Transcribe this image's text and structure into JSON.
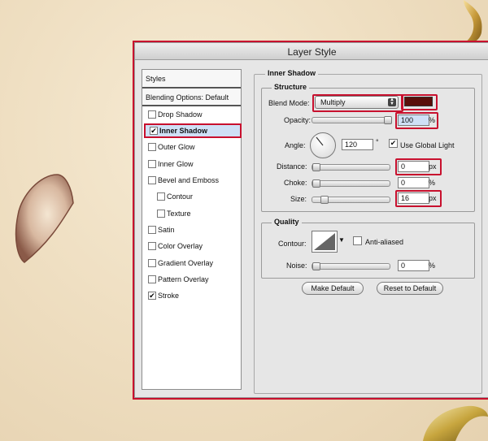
{
  "window": {
    "title": "Layer Style"
  },
  "styles_panel": {
    "header": "Styles",
    "blending_options": "Blending Options: Default",
    "items": [
      {
        "label": "Drop Shadow",
        "checked": false
      },
      {
        "label": "Inner Shadow",
        "checked": true,
        "selected": true
      },
      {
        "label": "Outer Glow",
        "checked": false
      },
      {
        "label": "Inner Glow",
        "checked": false
      },
      {
        "label": "Bevel and Emboss",
        "checked": false
      },
      {
        "label": "Contour",
        "checked": false,
        "indent": true
      },
      {
        "label": "Texture",
        "checked": false,
        "indent": true
      },
      {
        "label": "Satin",
        "checked": false
      },
      {
        "label": "Color Overlay",
        "checked": false
      },
      {
        "label": "Gradient Overlay",
        "checked": false
      },
      {
        "label": "Pattern Overlay",
        "checked": false
      },
      {
        "label": "Stroke",
        "checked": true
      }
    ]
  },
  "inner_shadow": {
    "section_title": "Inner Shadow",
    "structure": {
      "group_title": "Structure",
      "blend_mode_label": "Blend Mode:",
      "blend_mode_value": "Multiply",
      "shadow_color": "#5a0f0a",
      "opacity_label": "Opacity:",
      "opacity_value": "100",
      "opacity_unit": "%",
      "angle_label": "Angle:",
      "angle_value": "120",
      "angle_unit": "°",
      "use_global_light_label": "Use Global Light",
      "use_global_light_checked": true,
      "distance_label": "Distance:",
      "distance_value": "0",
      "distance_unit": "px",
      "choke_label": "Choke:",
      "choke_value": "0",
      "choke_unit": "%",
      "size_label": "Size:",
      "size_value": "16",
      "size_unit": "px"
    },
    "quality": {
      "group_title": "Quality",
      "contour_label": "Contour:",
      "anti_aliased_label": "Anti-aliased",
      "anti_aliased_checked": false,
      "noise_label": "Noise:",
      "noise_value": "0",
      "noise_unit": "%"
    },
    "buttons": {
      "make_default": "Make Default",
      "reset_to_default": "Reset to Default"
    }
  },
  "colors": {
    "highlight": "#c8102e",
    "selected_row": "#cfe0f6"
  }
}
